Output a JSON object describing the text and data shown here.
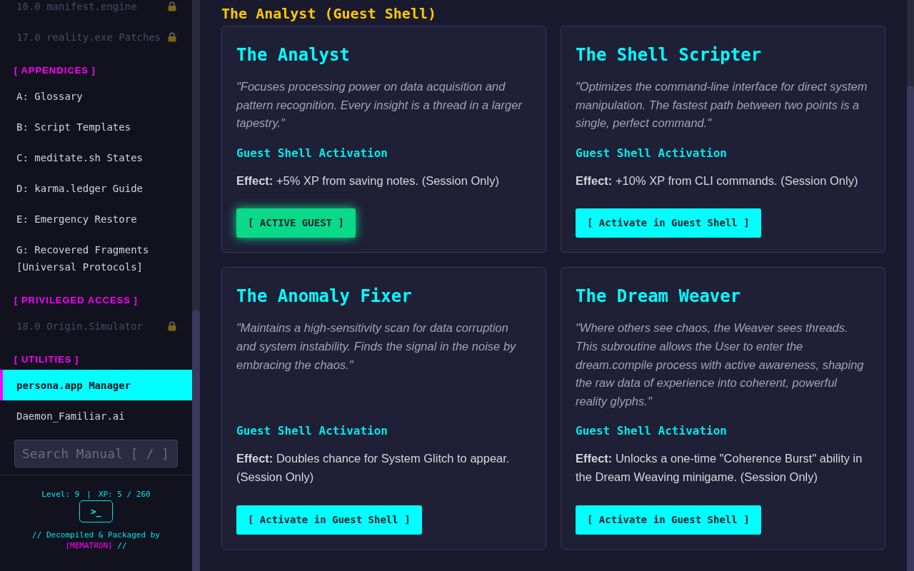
{
  "sidebar": {
    "sections": [
      {
        "items": [
          {
            "label": "16.0 manifest.engine",
            "locked": true,
            "selected": false
          },
          {
            "label": "17.0 reality.exe Patches",
            "locked": true,
            "selected": false
          }
        ]
      },
      {
        "title": "[ APPENDICES ]",
        "items": [
          {
            "label": "A: Glossary",
            "locked": false,
            "selected": false
          },
          {
            "label": "B: Script Templates",
            "locked": false,
            "selected": false
          },
          {
            "label": "C: meditate.sh States",
            "locked": false,
            "selected": false
          },
          {
            "label": "D: karma.ledger Guide",
            "locked": false,
            "selected": false
          },
          {
            "label": "E: Emergency Restore",
            "locked": false,
            "selected": false
          },
          {
            "label": "G: Recovered Fragments [Universal Protocols]",
            "locked": false,
            "selected": false
          }
        ]
      },
      {
        "title": "[ PRIVILEGED ACCESS ]",
        "items": [
          {
            "label": "18.0 Origin.Simulator",
            "locked": true,
            "selected": false
          }
        ]
      },
      {
        "title": "[ UTILITIES ]",
        "items": [
          {
            "label": "persona.app Manager",
            "locked": false,
            "selected": true
          },
          {
            "label": "Daemon_Familiar.ai",
            "locked": false,
            "selected": false
          }
        ]
      }
    ],
    "search": {
      "placeholder": "Search Manual [ / ]"
    },
    "footer": {
      "level": "Level: 9",
      "separator": "|",
      "xp": "XP: 5 / 260",
      "terminal_button": ">_",
      "credit": {
        "before": "// Decompiled & Packaged by",
        "highlight": "[MEMATRON]",
        "after": "//"
      }
    }
  },
  "main": {
    "heading": "The Analyst (Guest Shell)",
    "personas": [
      {
        "title": "The Analyst",
        "quote": "\"Focuses processing power on data acquisition and pattern recognition. Every insight is a thread in a larger tapestry.\"",
        "activation_heading": "Guest Shell Activation",
        "effect": "**Effect:** +5% XP from saving notes. (Session Only)",
        "button": {
          "label": "[ ACTIVE GUEST ]",
          "active": true
        }
      },
      {
        "title": "The Shell Scripter",
        "quote": "\"Optimizes the command-line interface for direct system manipulation. The fastest path between two points is a single, perfect command.\"",
        "activation_heading": "Guest Shell Activation",
        "effect": "**Effect:** +10% XP from CLI commands. (Session Only)",
        "button": {
          "label": "[ Activate in Guest Shell ]",
          "active": false
        }
      },
      {
        "title": "The Anomaly Fixer",
        "quote": "\"Maintains a high-sensitivity scan for data corruption and system instability. Finds the signal in the noise by embracing the chaos.\"",
        "activation_heading": "Guest Shell Activation",
        "effect": "**Effect:** Doubles chance for System Glitch to appear. (Session Only)",
        "button": {
          "label": "[ Activate in Guest Shell ]",
          "active": false
        }
      },
      {
        "title": "The Dream Weaver",
        "quote": "\"Where others see chaos, the Weaver sees threads. This subroutine allows the User to enter the dream.compile process with active awareness, shaping the raw data of experience into coherent, powerful reality glyphs.\"",
        "activation_heading": "Guest Shell Activation",
        "effect": "**Effect:** Unlocks a one-time \"Coherence Burst\" ability in the Dream Weaving minigame. (Session Only)",
        "button": {
          "label": "[ Activate in Guest Shell ]",
          "active": false
        }
      }
    ]
  }
}
